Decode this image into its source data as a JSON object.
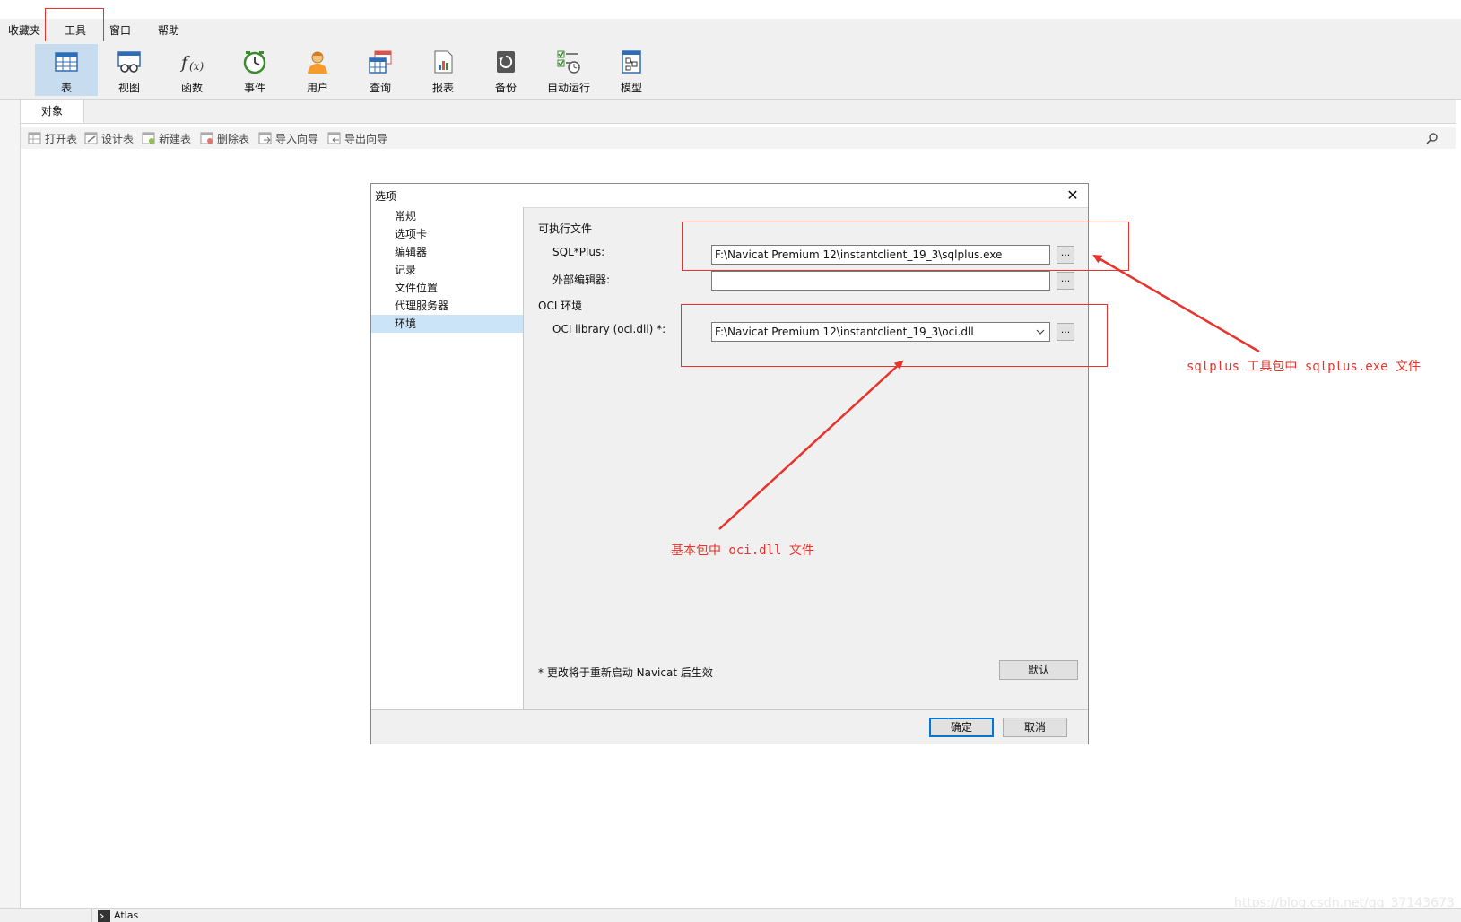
{
  "menu": {
    "items": [
      {
        "label": "收藏夹"
      },
      {
        "label": "工具"
      },
      {
        "label": "窗口"
      },
      {
        "label": "帮助"
      }
    ]
  },
  "toolbar": {
    "buttons": [
      {
        "label": "表",
        "icon": "table-icon"
      },
      {
        "label": "视图",
        "icon": "view-icon"
      },
      {
        "label": "函数",
        "icon": "function-icon"
      },
      {
        "label": "事件",
        "icon": "event-clock-icon"
      },
      {
        "label": "用户",
        "icon": "user-icon"
      },
      {
        "label": "查询",
        "icon": "query-icon"
      },
      {
        "label": "报表",
        "icon": "report-icon"
      },
      {
        "label": "备份",
        "icon": "backup-icon"
      },
      {
        "label": "自动运行",
        "icon": "automation-icon"
      },
      {
        "label": "模型",
        "icon": "model-icon"
      }
    ]
  },
  "tabs": {
    "objects_label": "对象"
  },
  "object_toolbar": {
    "buttons": [
      {
        "label": "打开表"
      },
      {
        "label": "设计表"
      },
      {
        "label": "新建表"
      },
      {
        "label": "删除表"
      },
      {
        "label": "导入向导"
      },
      {
        "label": "导出向导"
      }
    ]
  },
  "dialog": {
    "title": "选项",
    "close_glyph": "✕",
    "nav": [
      {
        "label": "常规"
      },
      {
        "label": "选项卡"
      },
      {
        "label": "编辑器"
      },
      {
        "label": "记录"
      },
      {
        "label": "文件位置"
      },
      {
        "label": "代理服务器"
      },
      {
        "label": "环境"
      }
    ],
    "section_exec": "可执行文件",
    "sqlplus_label": "SQL*Plus:",
    "sqlplus_value": "F:\\Navicat Premium 12\\instantclient_19_3\\sqlplus.exe",
    "external_editor_label": "外部编辑器:",
    "external_editor_value": "",
    "section_oci": "OCI 环境",
    "oci_label": "OCI library (oci.dll) *:",
    "oci_value": "F:\\Navicat Premium 12\\instantclient_19_3\\oci.dll",
    "browse_label": "...",
    "note": "* 更改将于重新启动 Navicat 后生效",
    "default_button": "默认",
    "ok_button": "确定",
    "cancel_button": "取消"
  },
  "annotations": {
    "sqlplus_note": "sqlplus 工具包中 sqlplus.exe 文件",
    "oci_note": "基本包中 oci.dll 文件",
    "color": "#e8322b"
  },
  "status": {
    "connection_label": "Atlas"
  },
  "watermark": "https://blog.csdn.net/qq_37143673"
}
